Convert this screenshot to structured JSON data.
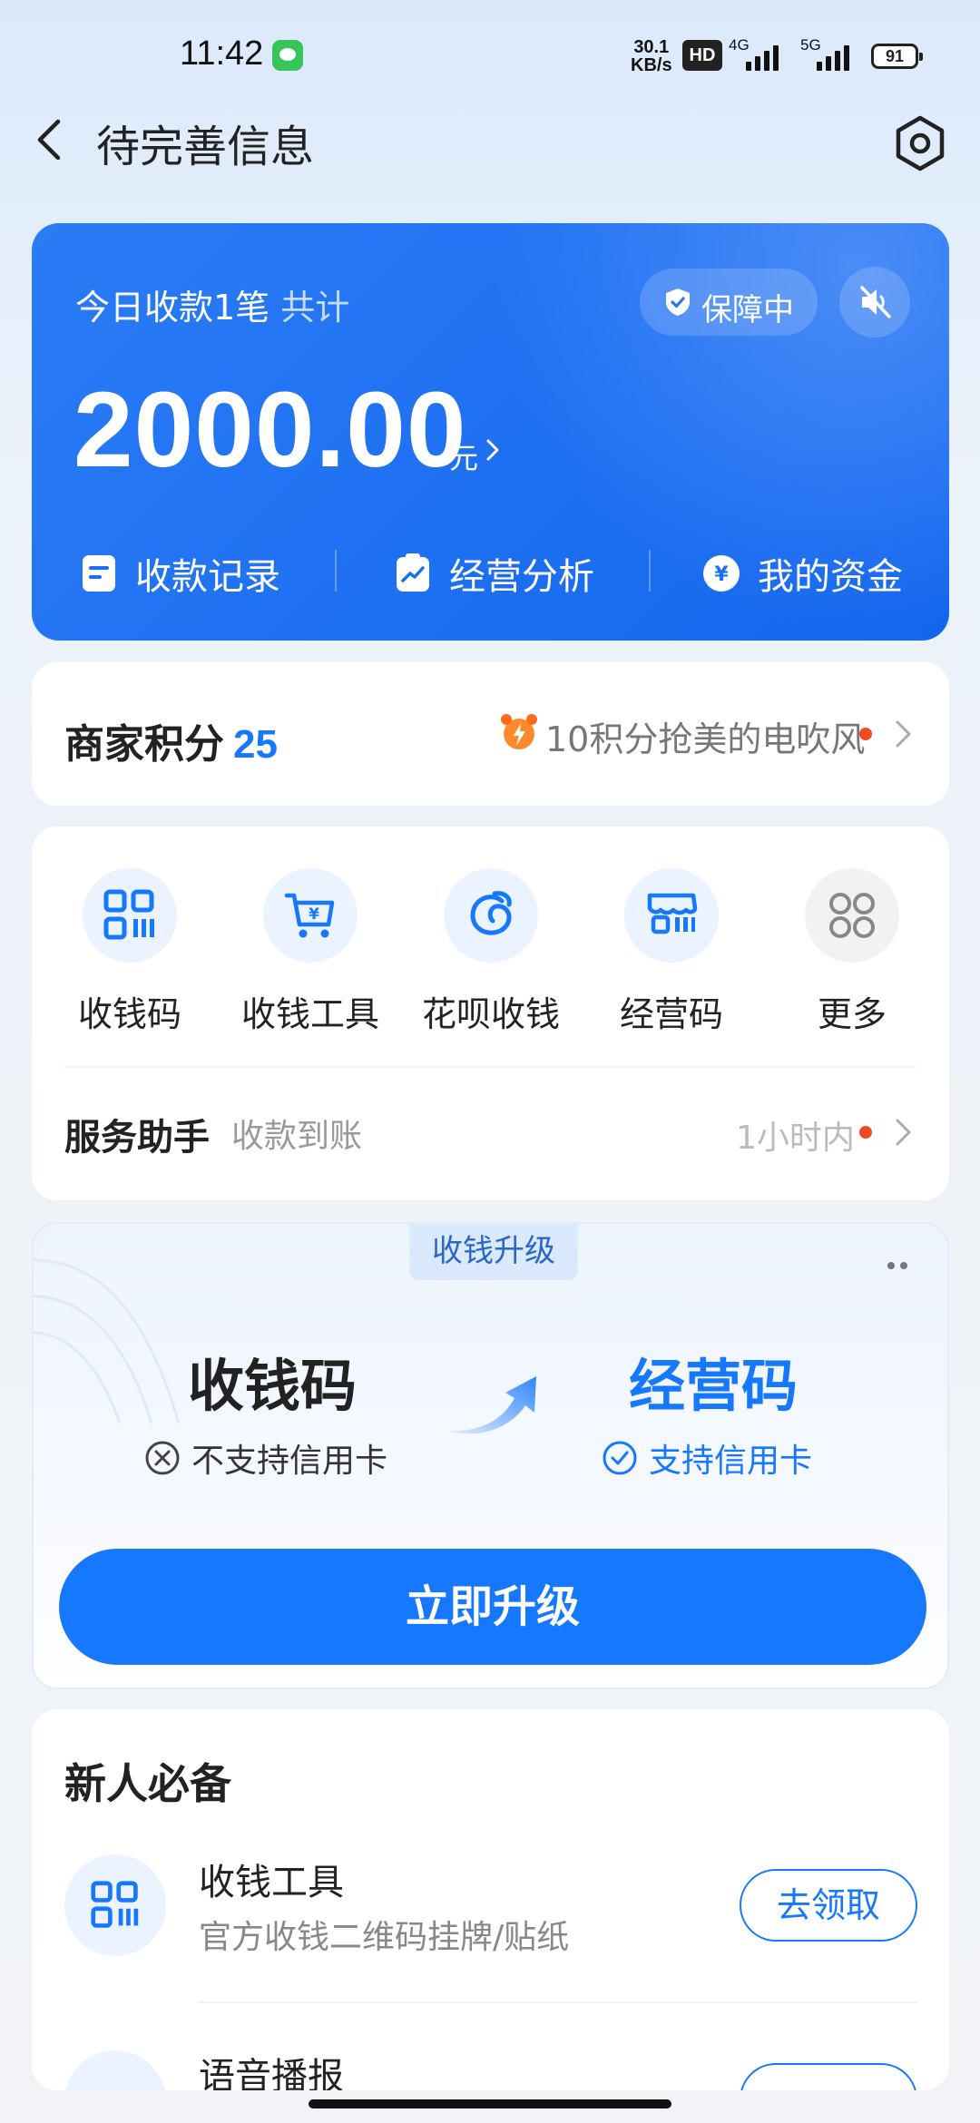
{
  "status_bar": {
    "time": "11:42",
    "net_speed_value": "30.1",
    "net_speed_unit": "KB/s",
    "hd": "HD",
    "sig1_label": "4G",
    "sig2_label": "5G",
    "battery": "91"
  },
  "header": {
    "title": "待完善信息"
  },
  "summary": {
    "today_label": "今日收款1笔",
    "total_label": "共计",
    "guard_label": "保障中",
    "amount": "2000.00",
    "unit": "元",
    "links": [
      {
        "label": "收款记录"
      },
      {
        "label": "经营分析"
      },
      {
        "label": "我的资金"
      }
    ]
  },
  "points": {
    "label": "商家积分",
    "value": "25",
    "promo": "10积分抢美的电吹风"
  },
  "tools": {
    "items": [
      {
        "label": "收钱码",
        "icon": "qr-code-icon"
      },
      {
        "label": "收钱工具",
        "icon": "cart-yen-icon"
      },
      {
        "label": "花呗收钱",
        "icon": "huabei-icon"
      },
      {
        "label": "经营码",
        "icon": "store-icon"
      },
      {
        "label": "更多",
        "icon": "grid-more-icon"
      }
    ],
    "assistant_title": "服务助手",
    "assistant_sub": "收款到账",
    "assistant_time": "1小时内"
  },
  "upgrade": {
    "tag": "收钱升级",
    "old_code": "收钱码",
    "old_note": "不支持信用卡",
    "new_code": "经营码",
    "new_note": "支持信用卡",
    "button": "立即升级"
  },
  "newbie": {
    "title": "新人必备",
    "items": [
      {
        "title": "收钱工具",
        "sub": "官方收钱二维码挂牌/贴纸",
        "button": "去领取"
      },
      {
        "title": "语音播报",
        "sub": "",
        "button": ""
      }
    ]
  },
  "colors": {
    "primary": "#1677ff",
    "accent_red": "#f04a24",
    "card_blue": "#1466ef"
  }
}
